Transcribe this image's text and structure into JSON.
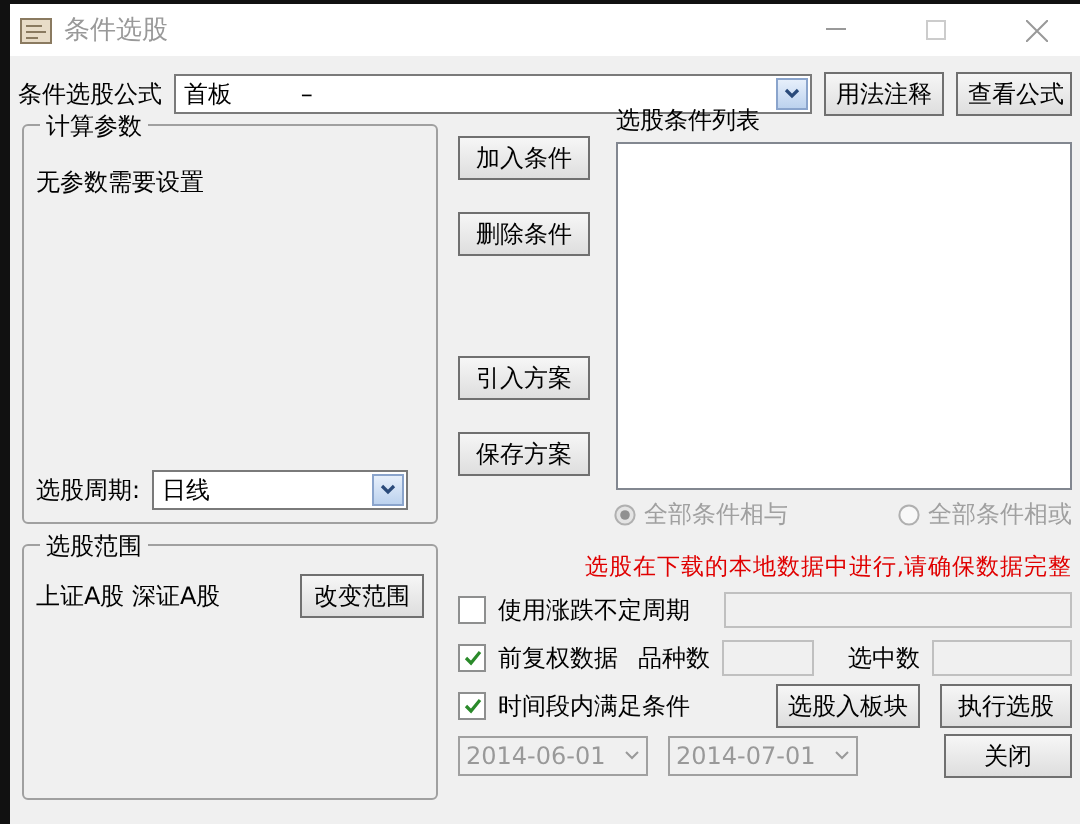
{
  "window": {
    "title": "条件选股",
    "active": false
  },
  "formula": {
    "label": "条件选股公式",
    "value": "首板         –"
  },
  "formula_buttons": [
    "用法注释",
    "查看公式"
  ],
  "params": {
    "title": "计算参数",
    "message": "无参数需要设置",
    "period_label": "选股周期:",
    "period_value": "日线"
  },
  "actions": [
    "加入条件",
    "删除条件",
    "引入方案",
    "保存方案"
  ],
  "conditions": {
    "label": "选股条件列表"
  },
  "logic": [
    {
      "label": "全部条件相与",
      "selected": true,
      "disabled": true
    },
    {
      "label": "全部条件相或",
      "selected": false,
      "disabled": true
    }
  ],
  "notice": "选股在下载的本地数据中进行,请确保数据完整",
  "scope": {
    "title": "选股范围",
    "markets": "上证A股 深证A股",
    "button": "改变范围"
  },
  "options": [
    {
      "label": "使用涨跌不定周期",
      "checked": false
    },
    {
      "label": "前复权数据",
      "checked": true
    },
    {
      "label": "时间段内满足条件",
      "checked": true
    }
  ],
  "counts": [
    {
      "label": "品种数"
    },
    {
      "label": "选中数"
    }
  ],
  "dates": [
    "2014-06-01",
    "2014-07-01"
  ],
  "bottom_buttons": [
    "选股入板块",
    "执行选股",
    "关闭"
  ]
}
